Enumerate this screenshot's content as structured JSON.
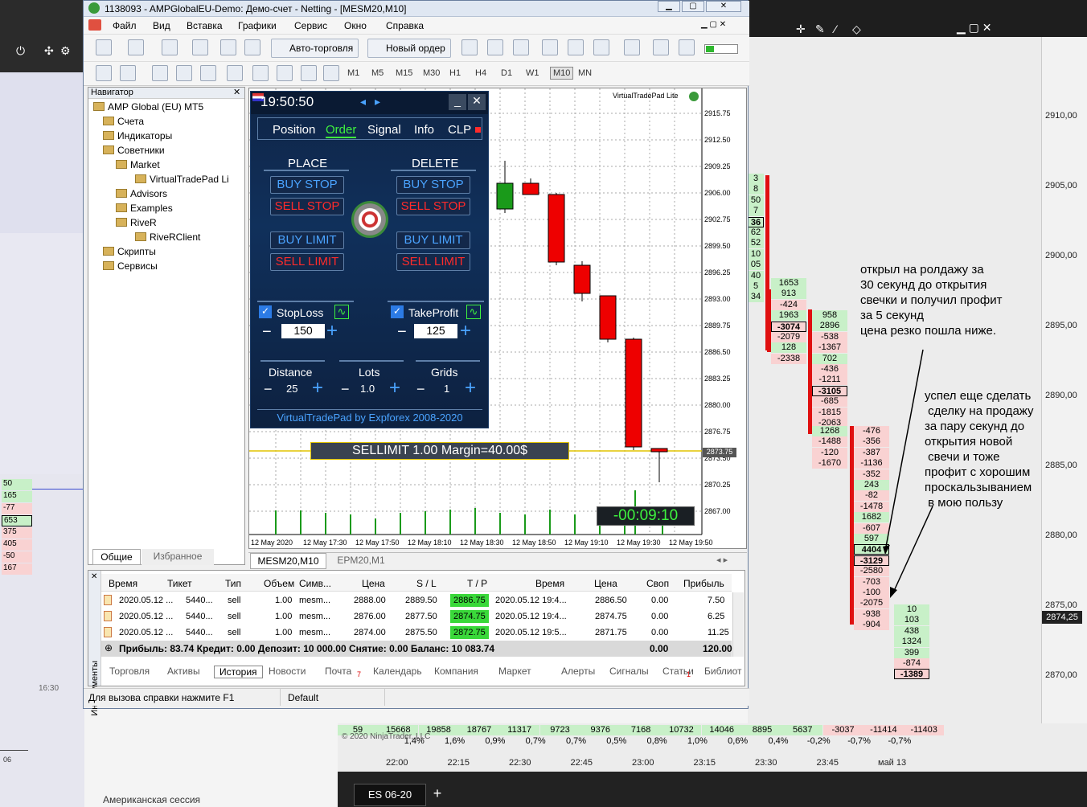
{
  "window": {
    "title": "1138093 - AMPGlobalEU-Demo: Демо-счет - Netting - [MESM20,M10]"
  },
  "menu": [
    "Файл",
    "Вид",
    "Вставка",
    "Графики",
    "Сервис",
    "Окно",
    "Справка"
  ],
  "toolbar": {
    "autotrade": "Авто-торговля",
    "new_order": "Новый ордер"
  },
  "timeframes": [
    "M1",
    "M5",
    "M15",
    "M30",
    "H1",
    "H4",
    "D1",
    "W1",
    "M10",
    "MN"
  ],
  "navigator": {
    "title": "Навигатор",
    "items": [
      "AMP Global (EU) MT5",
      "Счета",
      "Индикаторы",
      "Советники",
      "Market",
      "VirtualTradePad Li",
      "Advisors",
      "Examples",
      "RiveR",
      "RiveRClient",
      "Скрипты",
      "Сервисы"
    ],
    "tabs": [
      "Общие",
      "Избранное"
    ]
  },
  "vtp": {
    "clock": "19:50:50",
    "tabs": [
      "Position",
      "Order",
      "Signal",
      "Info",
      "CLP"
    ],
    "place": "PLACE",
    "delete": "DELETE",
    "buttons": [
      "BUY STOP",
      "SELL STOP",
      "BUY LIMIT",
      "SELL LIMIT"
    ],
    "stoploss_label": "StopLoss",
    "stoploss_value": "150",
    "takeprofit_label": "TakeProfit",
    "takeprofit_value": "125",
    "distance_label": "Distance",
    "distance_value": "25",
    "lots_label": "Lots",
    "lots_value": "1.0",
    "grids_label": "Grids",
    "grids_value": "1",
    "footer": "VirtualTradePad by Expforex 2008-2020",
    "order_banner": "SELLIMIT 1.00 Margin=40.00$",
    "countdown": "-00:09:10",
    "chart_label": "VirtualTradePad Lite"
  },
  "chart": {
    "y_labels": [
      "2915.75",
      "2912.50",
      "2909.25",
      "2906.00",
      "2902.75",
      "2899.50",
      "2896.25",
      "2893.00",
      "2889.75",
      "2886.50",
      "2883.25",
      "2880.00",
      "2876.75",
      "2873.50",
      "2870.25",
      "2867.00"
    ],
    "current_price": "2873.75",
    "x_labels": [
      "12 May 2020",
      "12 May 17:30",
      "12 May 17:50",
      "12 May 18:10",
      "12 May 18:30",
      "12 May 18:50",
      "12 May 19:10",
      "12 May 19:30",
      "12 May 19:50"
    ],
    "tabs": [
      "MESM20,M10",
      "EPM20,M1"
    ]
  },
  "terminal": {
    "headers": [
      "Время",
      "Тикет",
      "Тип",
      "Объем",
      "Симв...",
      "Цена",
      "S / L",
      "T / P",
      "Время",
      "Цена",
      "Своп",
      "Прибыль"
    ],
    "rows": [
      [
        "2020.05.12 ...",
        "5440...",
        "sell",
        "1.00",
        "mesm...",
        "2888.00",
        "2889.50",
        "2886.75",
        "2020.05.12 19:4...",
        "2886.50",
        "0.00",
        "7.50"
      ],
      [
        "2020.05.12 ...",
        "5440...",
        "sell",
        "1.00",
        "mesm...",
        "2876.00",
        "2877.50",
        "2874.75",
        "2020.05.12 19:4...",
        "2874.75",
        "0.00",
        "6.25"
      ],
      [
        "2020.05.12 ...",
        "5440...",
        "sell",
        "1.00",
        "mesm...",
        "2874.00",
        "2875.50",
        "2872.75",
        "2020.05.12 19:5...",
        "2871.75",
        "0.00",
        "11.25"
      ]
    ],
    "summary": "Прибыль: 83.74  Кредит: 0.00  Депозит: 10 000.00  Снятие: 0.00  Баланс: 10 083.74",
    "summary_swap": "0.00",
    "summary_profit": "120.00",
    "side_label": "Инструменты",
    "tabs": [
      "Торговля",
      "Активы",
      "История",
      "Новости",
      "Почта",
      "Календарь",
      "Компания",
      "Маркет",
      "Алерты",
      "Сигналы",
      "Статьи",
      "Библиот"
    ],
    "mail_badge": "7",
    "articles_badge": "1"
  },
  "status": {
    "help": "Для вызова справки нажмите F1",
    "profile": "Default"
  },
  "ninja": {
    "price_labels": [
      "2910,00",
      "2905,00",
      "2900,00",
      "2895,00",
      "2890,00",
      "2885,00",
      "2880,00",
      "2875,00",
      "2870,00"
    ],
    "current_price": "2874,25",
    "col1": [
      "3",
      "8",
      "50",
      "7",
      "36",
      "62",
      "52",
      "10",
      "05",
      "40",
      "5",
      "34"
    ],
    "col2": [
      "1653",
      "913",
      "-424",
      "1963",
      "-3074",
      "-2079",
      "128",
      "-2338"
    ],
    "col3": [
      "958",
      "2896",
      "-538",
      "-1367",
      "702",
      "-436",
      "-1211",
      "-3105",
      "-685",
      "-1815",
      "-2063"
    ],
    "col4": [
      "1268",
      "-1488",
      "-120",
      "-1670"
    ],
    "col5": [
      "-476",
      "-356",
      "-387",
      "-1136",
      "-352",
      "243",
      "-82",
      "-1478",
      "1682",
      "-607",
      "597",
      "4404",
      "-3129",
      "-2580",
      "-703",
      "-100",
      "-2075",
      "-938",
      "-904"
    ],
    "col6": [
      "10",
      "103",
      "438",
      "1324",
      "399",
      "-874",
      "-1389"
    ],
    "annotation1": "открыл на ролдажу за\n30 секунд до открытия\nсвечки и получил профит\nза 5 секунд\nцена резко пошла ниже.",
    "annotation2": "успел еще сделать\n сделку на продажу\nза пару секунд до\nоткрытия новой\n свечи и тоже\nпрофит с хорошим\nпроскальзыванием\n в мою пользу",
    "bottom_values": [
      "59",
      "15668",
      "19858",
      "18767",
      "11317",
      "9723",
      "9376",
      "7168",
      "10732",
      "14046",
      "8895",
      "5637",
      "-3037",
      "-11414",
      "-11403"
    ],
    "bottom_pcts": [
      "1,4%",
      "1,6%",
      "0,9%",
      "0,7%",
      "0,7%",
      "0,5%",
      "0,8%",
      "1,0%",
      "0,6%",
      "0,4%",
      "-0,2%",
      "-0,7%",
      "-0,7%"
    ],
    "copyright": "© 2020 NinjaTrader, LLC",
    "times": [
      "22:00",
      "22:15",
      "22:30",
      "22:45",
      "23:00",
      "23:15",
      "23:30",
      "23:45",
      "май 13"
    ],
    "tab": "ES 06-20",
    "tab_add": "+"
  },
  "left_panel": {
    "values": [
      "50",
      "165",
      "-77",
      "653",
      "375",
      "405",
      "-50",
      "167"
    ],
    "time": "16:30",
    "session": "Американская сессия",
    "axis": "06"
  }
}
